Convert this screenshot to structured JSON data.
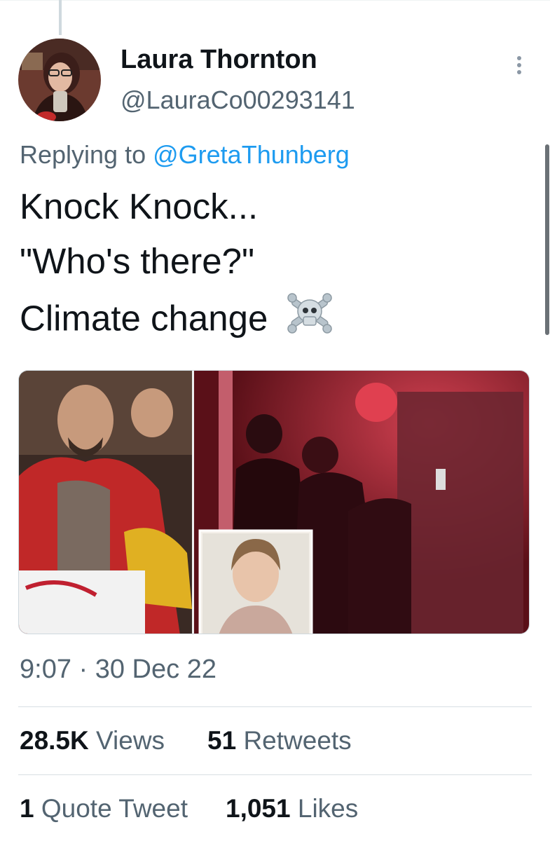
{
  "tweet": {
    "author_name": "Laura Thornton",
    "author_handle": "@LauraCo00293141",
    "replying_to_prefix": "Replying to",
    "replying_to_handle": "@GretaThunberg",
    "text_lines": [
      "Knock Knock...",
      "\"Who's there?\"",
      "Climate change"
    ],
    "emoji": "☠️",
    "timestamp": "9:07 · 30 Dec 22"
  },
  "stats": {
    "views_count": "28.5K",
    "views_label": "Views",
    "retweets_count": "51",
    "retweets_label": "Retweets",
    "quotes_count": "1",
    "quotes_label": "Quote Tweet",
    "likes_count": "1,051",
    "likes_label": "Likes"
  },
  "icons": {
    "more": "more-options-icon"
  },
  "colors": {
    "link": "#1d9bf0",
    "secondary_text": "#536471",
    "primary_text": "#0f1419"
  }
}
